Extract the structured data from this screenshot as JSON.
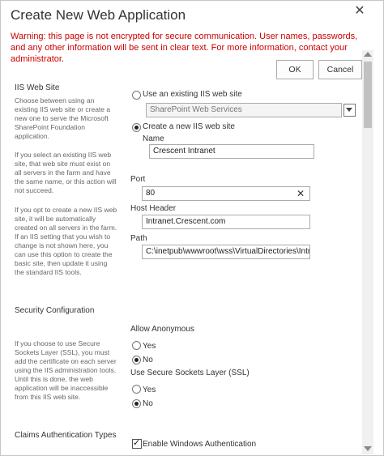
{
  "dialog": {
    "title": "Create New Web Application",
    "close_glyph": "✕",
    "warning": "Warning: this page is not encrypted for secure communication. User names, passwords, and any other information will be sent in clear text. For more information, contact your administrator.",
    "ok_label": "OK",
    "cancel_label": "Cancel"
  },
  "iis": {
    "section_title": "IIS Web Site",
    "desc": [
      "Choose between using an existing IIS web site or create a new one to serve the Microsoft SharePoint Foundation application.",
      "If you select an existing IIS web site, that web site must exist on all servers in the farm and have the same name, or this action will not succeed.",
      "If you opt to create a new IIS web site, it will be automatically created on all servers in the farm.  If an IIS setting that you wish to change is not shown here, you can use this option to create the basic site, then update it using the standard IIS tools."
    ],
    "use_existing_label": "Use an existing IIS web site",
    "existing_site_value": "SharePoint Web Services",
    "create_new_label": "Create a new IIS web site",
    "name_label": "Name",
    "name_value": "Crescent Intranet",
    "port_label": "Port",
    "port_value": "80",
    "clear_glyph": "✕",
    "host_header_label": "Host Header",
    "host_header_value": "Intranet.Crescent.com",
    "path_label": "Path",
    "path_value": "C:\\inetpub\\wwwroot\\wss\\VirtualDirectories\\Intr"
  },
  "security": {
    "section_title": "Security Configuration",
    "desc": "If you choose to use Secure Sockets Layer (SSL), you must add the certificate on each server using the IIS administration tools.  Until this is done, the web application will be inaccessible from this IIS web site.",
    "allow_anonymous_label": "Allow Anonymous",
    "anon_yes_label": "Yes",
    "anon_no_label": "No",
    "ssl_label": "Use Secure Sockets Layer (SSL)",
    "ssl_yes_label": "Yes",
    "ssl_no_label": "No"
  },
  "claims": {
    "section_title": "Claims Authentication Types",
    "enable_windows_label": "Enable Windows Authentication"
  }
}
